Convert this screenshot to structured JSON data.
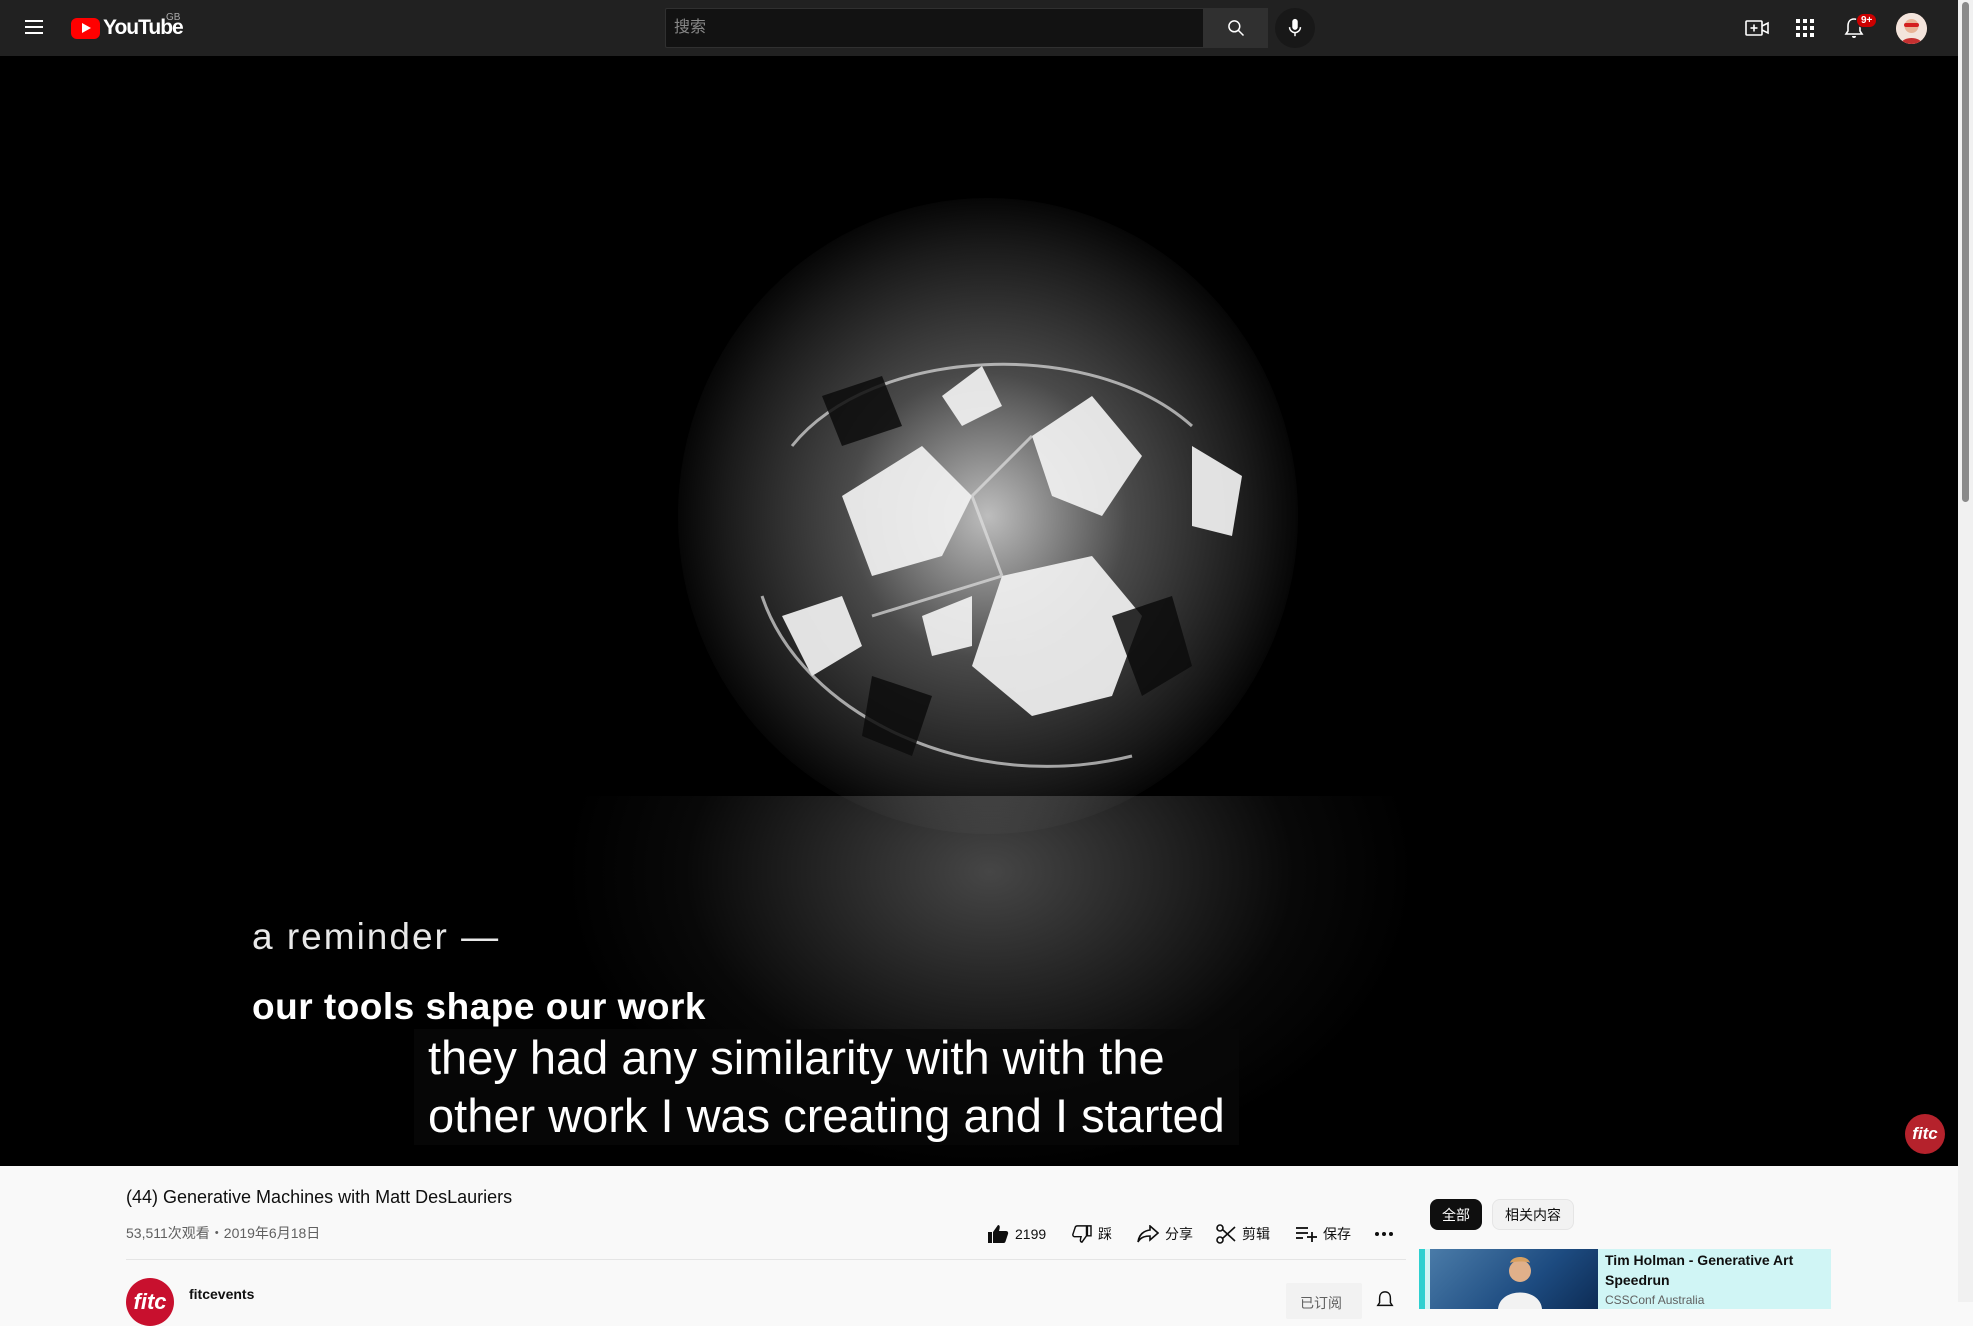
{
  "header": {
    "logo_text": "YouTube",
    "region": "GB",
    "search_placeholder": "搜索",
    "notification_count": "9+"
  },
  "video": {
    "slide_line1": "a reminder —",
    "slide_line2": "our tools shape our work",
    "caption_line1": "they had any similarity with with the",
    "caption_line2": "other work I was creating and I started",
    "watermark": "fitc"
  },
  "info": {
    "title": "(44) Generative Machines with Matt DesLauriers",
    "meta": "53,511次观看・2019年6月18日",
    "likes": "2199",
    "dislike_label": "踩",
    "share_label": "分享",
    "clip_label": "剪辑",
    "save_label": "保存"
  },
  "channel": {
    "name": "fitcevents",
    "avatar_text": "fitc",
    "subscribed_label": "已订阅"
  },
  "sidebar": {
    "chips": [
      "全部",
      "相关内容"
    ],
    "recommendation": {
      "title": "Tim Holman - Generative Art Speedrun",
      "channel": "CSSConf Australia"
    }
  },
  "colors": {
    "topbar_bg": "#212121",
    "brand_red": "#ff0000",
    "highlight": "#d0f5f5"
  }
}
